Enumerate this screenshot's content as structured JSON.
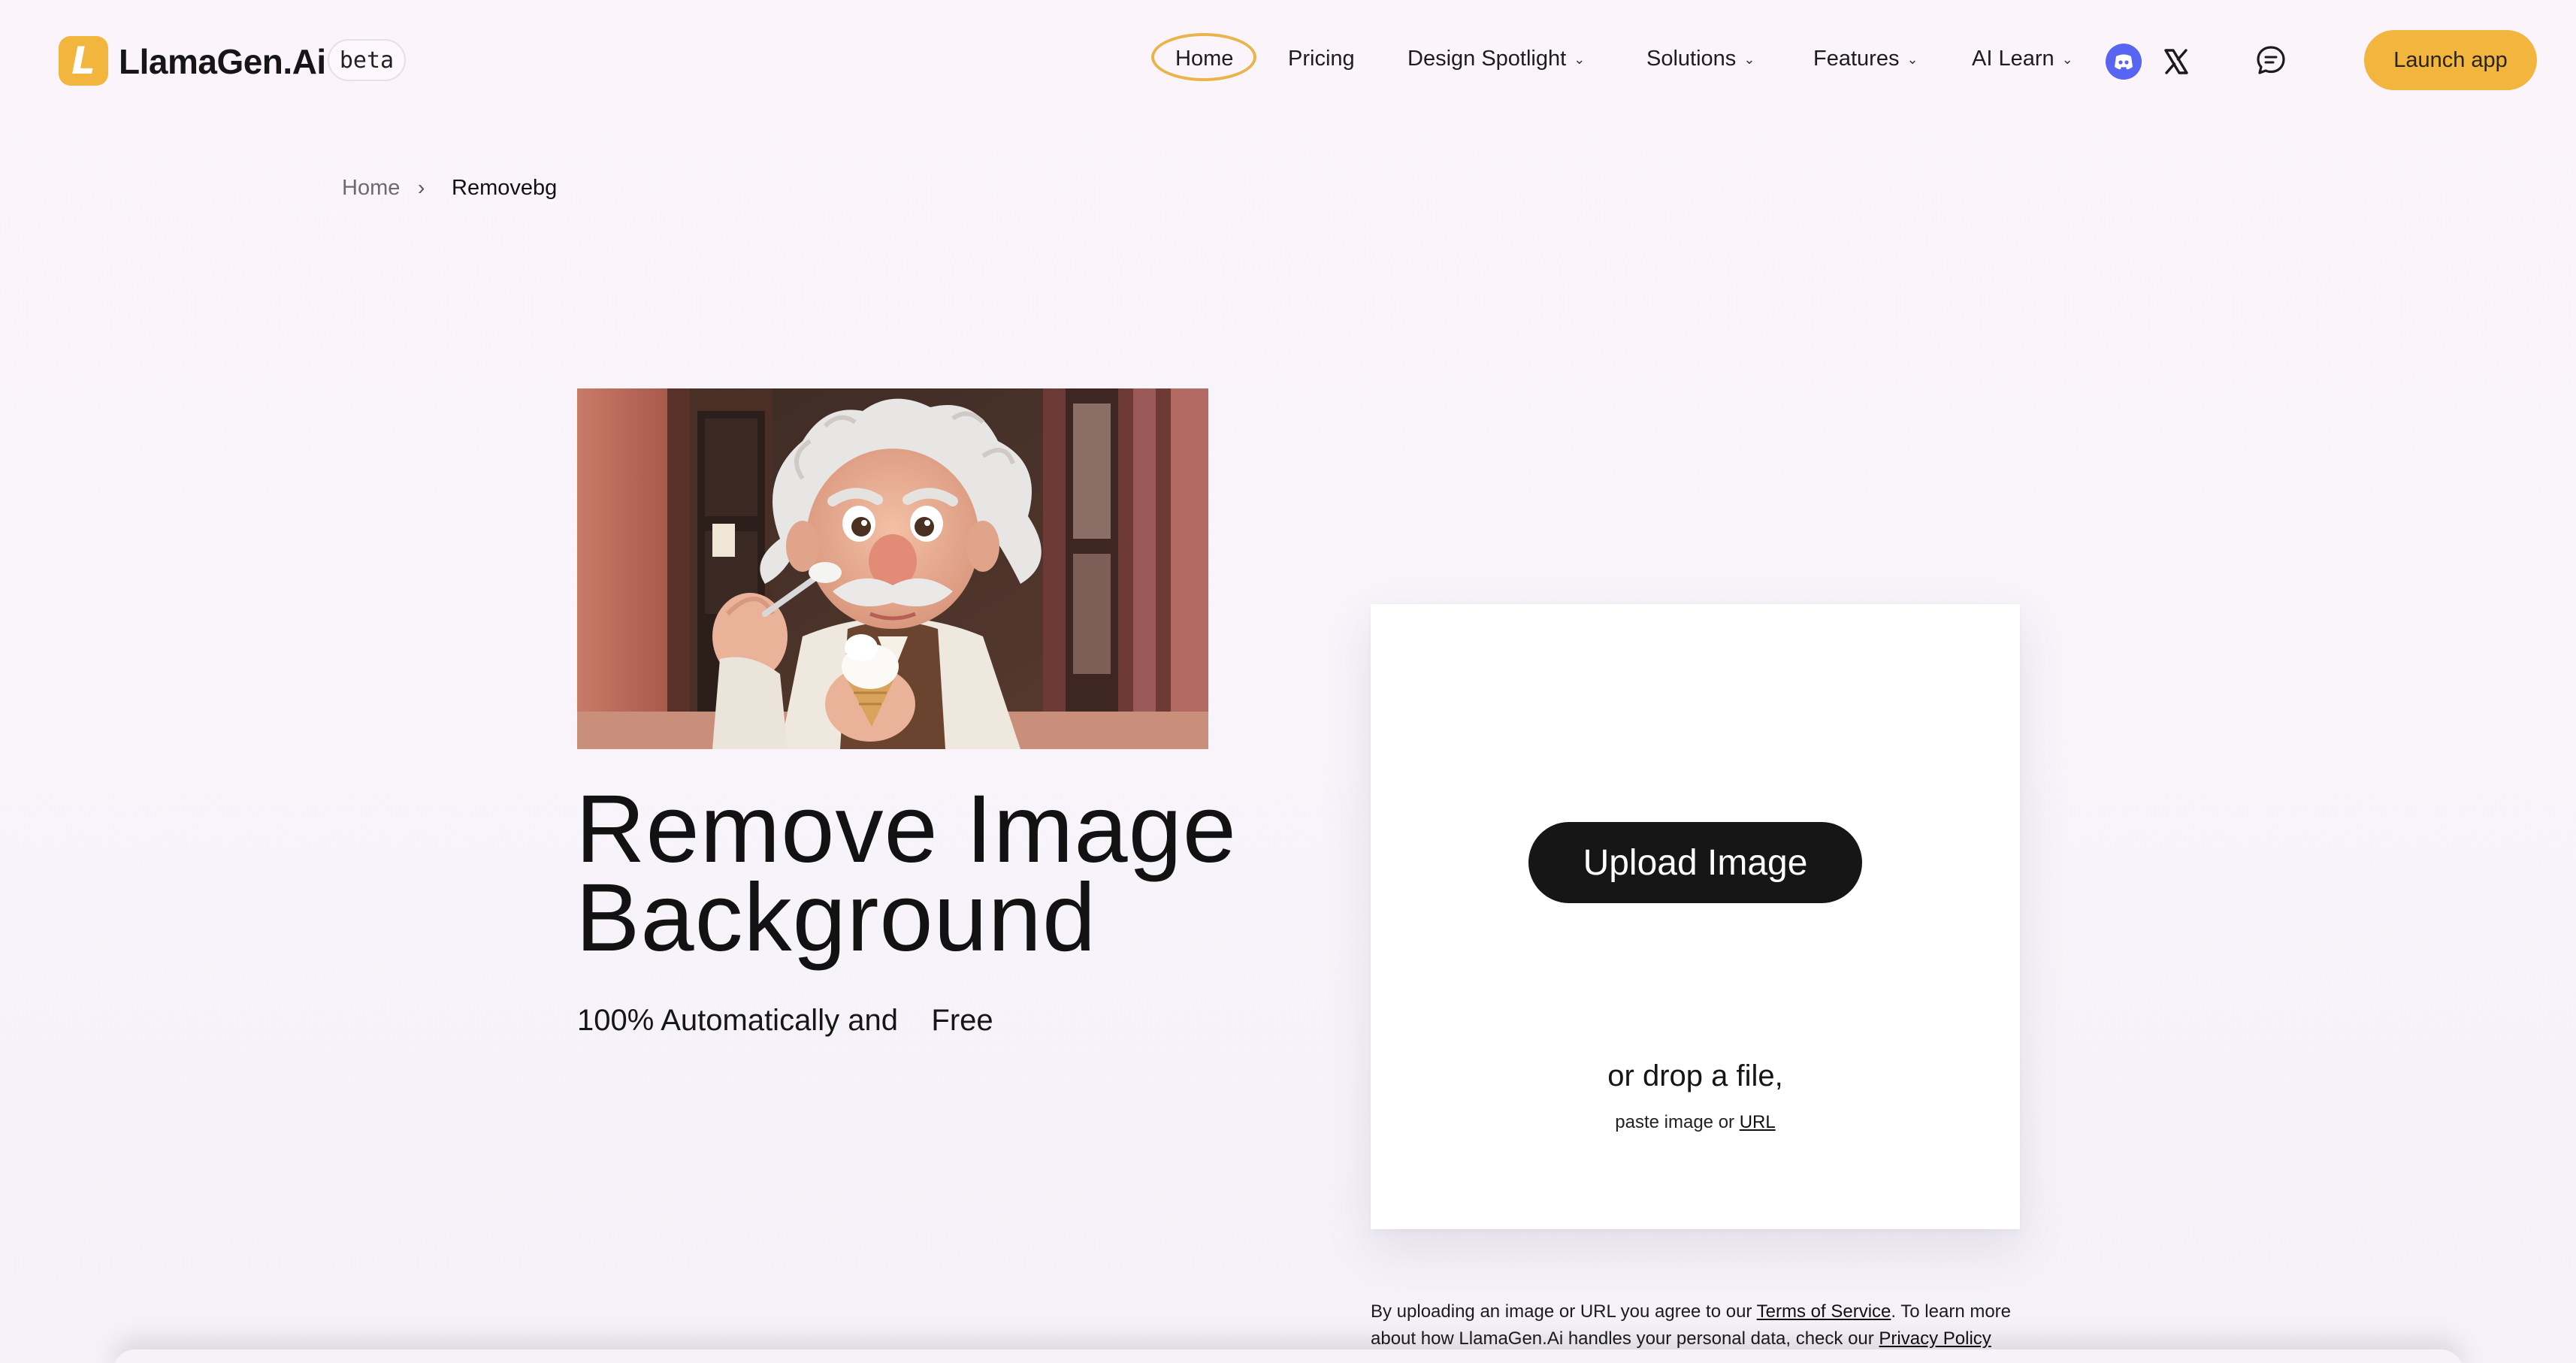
{
  "brand": {
    "name": "LlamaGen.Ai",
    "logo_letter": "L",
    "badge": "beta",
    "accent_color": "#f2b53e"
  },
  "nav": {
    "home": "Home",
    "pricing": "Pricing",
    "design_spotlight": "Design Spotlight",
    "solutions": "Solutions",
    "features": "Features",
    "ai_learn": "AI Learn",
    "icons": [
      "discord-icon",
      "x-icon",
      "chat-icon"
    ],
    "launch": "Launch app"
  },
  "breadcrumb": {
    "home": "Home",
    "separator": "›",
    "current": "Removebg"
  },
  "hero": {
    "title_line1": "Remove Image",
    "title_line2": "Background",
    "subtitle": "100% Automatically and    Free"
  },
  "upload": {
    "button": "Upload Image",
    "drop": "or drop a file,",
    "paste_prefix": "paste image or ",
    "paste_link": "URL"
  },
  "legal": {
    "p1": "By uploading an image or URL you agree to our ",
    "tos": "Terms of Service",
    "p2": ". To learn more about how LlamaGen.Ai handles your personal data, check our ",
    "privacy": "Privacy Policy"
  }
}
